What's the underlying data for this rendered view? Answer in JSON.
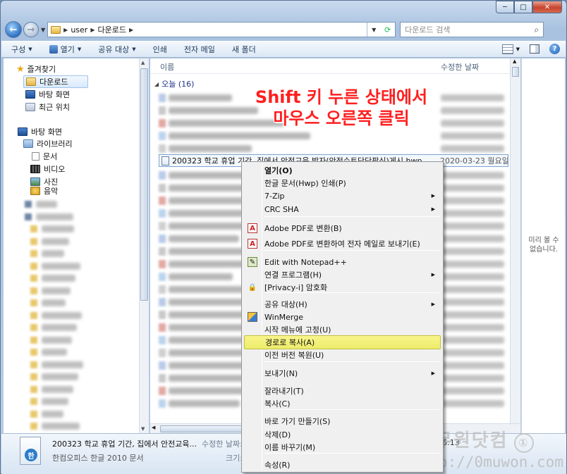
{
  "window": {
    "controls": [
      "─",
      "□",
      "✕"
    ]
  },
  "address": {
    "segments": [
      "user",
      "다운로드"
    ],
    "search_placeholder": "다운로드 검색"
  },
  "toolbar": {
    "organize": "구성",
    "open": "열기",
    "share": "공유 대상",
    "print": "인쇄",
    "email": "전자 메일",
    "new_folder": "새 폴더"
  },
  "nav": {
    "favorites": "즐겨찾기",
    "downloads": "다운로드",
    "desktop": "바탕 화면",
    "recent": "최근 위치",
    "desktop_root": "바탕 화면",
    "libraries": "라이브러리",
    "documents": "문서",
    "videos": "비디오",
    "pictures": "사진",
    "music": "음악"
  },
  "list": {
    "col_name": "이름",
    "col_modified": "수정한 날짜",
    "group_today": "오늘 (16)",
    "selected_file": {
      "name": "200323 학교 휴업 기간, 집에서 안전교육 받자(안전수트단단팡신)게시.hwp",
      "date": "2020-03-23 월요일 오"
    }
  },
  "preview": {
    "message_line1": "미리 볼 수",
    "message_line2": "없습니다."
  },
  "details": {
    "name": "200323 학교 휴업 기간, 집에서 안전교육...",
    "type": "한컴오피스 한글 2010 문서",
    "modified_label": "수정한 날짜:",
    "size_label": "크기:",
    "time_fragment": "6:13"
  },
  "annotation": {
    "line1": "Shift 키 누른 상태에서",
    "line2": "마우스 오른쪽 클릭"
  },
  "context_menu": {
    "items": [
      {
        "label": "열기(O)",
        "bold": true
      },
      {
        "label": "한글 문서(Hwp) 인쇄(P)"
      },
      {
        "label": "7-Zip",
        "sub": true
      },
      {
        "label": "CRC SHA",
        "sub": true
      },
      {
        "label": "Adobe PDF로 변환(B)",
        "icon": "adobe-pdf-icon"
      },
      {
        "label": "Adobe PDF로 변환하여 전자 메일로 보내기(E)",
        "icon": "adobe-pdf-mail-icon"
      },
      {
        "label": "Edit with Notepad++",
        "icon": "notepad-plus-plus-icon"
      },
      {
        "label": "연결 프로그램(H)",
        "sub": true
      },
      {
        "label": "[Privacy-i] 암호화",
        "icon": "lock-icon"
      },
      {
        "label": "공유 대상(H)",
        "sub": true
      },
      {
        "label": "WinMerge",
        "icon": "winmerge-icon"
      },
      {
        "label": "시작 메뉴에 고정(U)"
      },
      {
        "label": "경로로 복사(A)",
        "highlighted": true
      },
      {
        "label": "이전 버전 복원(U)"
      },
      {
        "label": "보내기(N)",
        "sub": true
      },
      {
        "label": "잘라내기(T)"
      },
      {
        "label": "복사(C)"
      },
      {
        "label": "바로 가기 만들기(S)"
      },
      {
        "label": "삭제(D)"
      },
      {
        "label": "이름 바꾸기(M)"
      },
      {
        "label": "속성(R)"
      }
    ]
  },
  "watermark": {
    "site_name": "공무원닷컴",
    "badge": "①",
    "url": "http://0muwon.com"
  },
  "colors": {
    "annotation_red": "#ff1f1f",
    "highlight_yellow": "#f3f17a",
    "group_header_blue": "#1e3287"
  }
}
